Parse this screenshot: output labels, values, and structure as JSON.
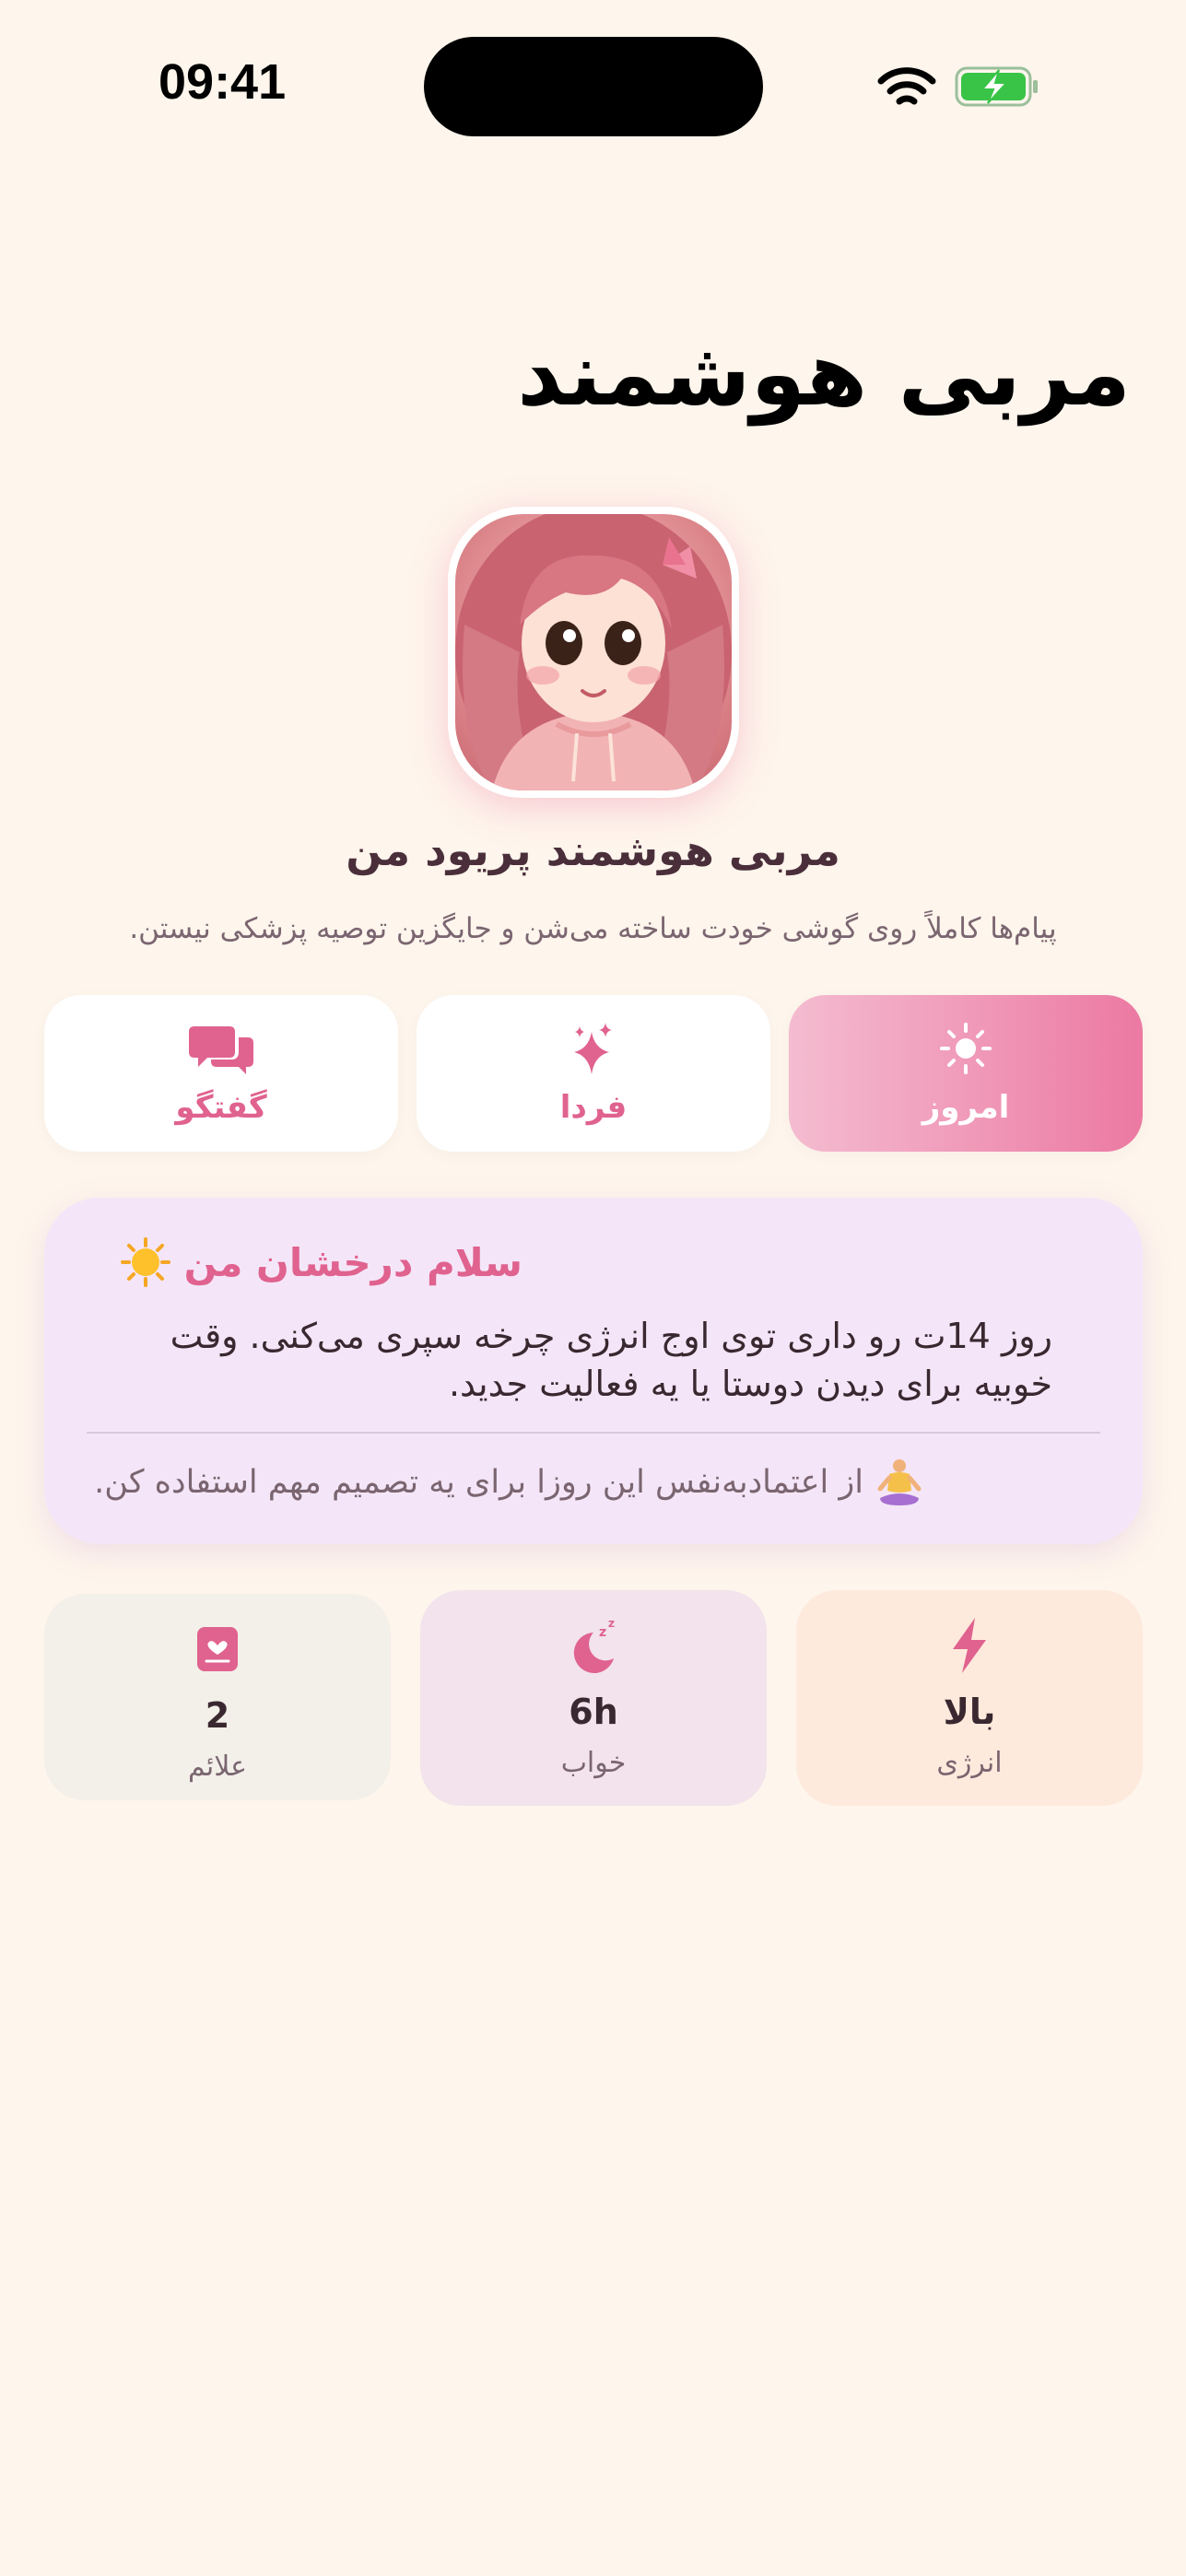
{
  "status_bar": {
    "time": "09:41"
  },
  "header": {
    "title": "مربی هوشمند"
  },
  "profile": {
    "name": "مربی هوشمند پریود من",
    "disclaimer": "پیام‌ها کاملاً روی گوشی خودت ساخته می‌شن و جایگزین توصیه پزشکی نیستن."
  },
  "tabs": [
    {
      "label": "امروز",
      "icon": "sun-icon",
      "active": true
    },
    {
      "label": "فردا",
      "icon": "sparkles-icon",
      "active": false
    },
    {
      "label": "گفتگو",
      "icon": "chat-bubbles-icon",
      "active": false
    }
  ],
  "insight": {
    "greeting": "سلام درخشان من",
    "greeting_emoji": "sun-emoji",
    "body": "روز 14ت رو داری توی اوج انرژی چرخه سپری می‌کنی. وقت خوبیه برای دیدن دوستا یا یه فعالیت جدید.",
    "tip": "از اعتمادبه‌نفس این روزا برای یه تصمیم مهم استفاده کن.",
    "tip_emoji": "meditation-emoji"
  },
  "stats": [
    {
      "value": "بالا",
      "label": "انرژی",
      "icon": "lightning-icon"
    },
    {
      "value": "6h",
      "label": "خواب",
      "icon": "moon-sleep-icon"
    },
    {
      "value": "2",
      "label": "علائم",
      "icon": "journal-heart-icon"
    }
  ],
  "colors": {
    "background": "#FEF5EC",
    "accent": "#E0628F",
    "card": "#F4E6F8",
    "text_primary": "#3A2830",
    "text_secondary": "#7A6570"
  }
}
